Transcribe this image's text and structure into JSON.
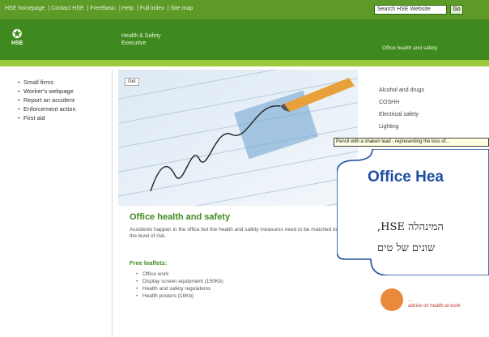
{
  "topnav": {
    "items": [
      "HSE homepage",
      "Contact HSE",
      "FreeBasic",
      "Help",
      "Full index",
      "Site map"
    ],
    "search_placeholder": "Search HSE Website",
    "search_button": "Go"
  },
  "header": {
    "logo_text": "HSE",
    "section_title_1": "Health & Safety",
    "section_title_2": "Executive",
    "right_text": "Office health and safety"
  },
  "leftnav": {
    "items": [
      "Small firms",
      "Worker's webpage",
      "Report an accident",
      "Enforcement action",
      "First aid"
    ]
  },
  "hero": {
    "tag": "Get"
  },
  "content": {
    "title": "Office health and safety",
    "intro": "Accidents happen in the office but the health and safety measures need to be matched to the level of risk.",
    "leaflets_heading": "Free leaflets:",
    "leaflets": [
      "Office work",
      "Display screen equipment (150Kb)",
      "Health and safety regulations",
      "Health posters (16Kb)"
    ]
  },
  "rightlinks": {
    "items": [
      "Alcohol and drugs",
      "COSHH",
      "Electrical safety",
      "Lighting"
    ]
  },
  "tooltip": {
    "text": "Pencil with a shaken lead - representing the loss of..."
  },
  "callout": {
    "title": "Office Hea",
    "line1": "המינהלה HSE,",
    "line2": "שונים של טים"
  },
  "promo": {
    "text_1": "...",
    "text_2": "advice on health at work"
  },
  "colors": {
    "green_dark": "#3f8a1e",
    "green_mid": "#5d9a28",
    "green_light": "#9dc93d",
    "callout_border": "#1f4fa1"
  }
}
